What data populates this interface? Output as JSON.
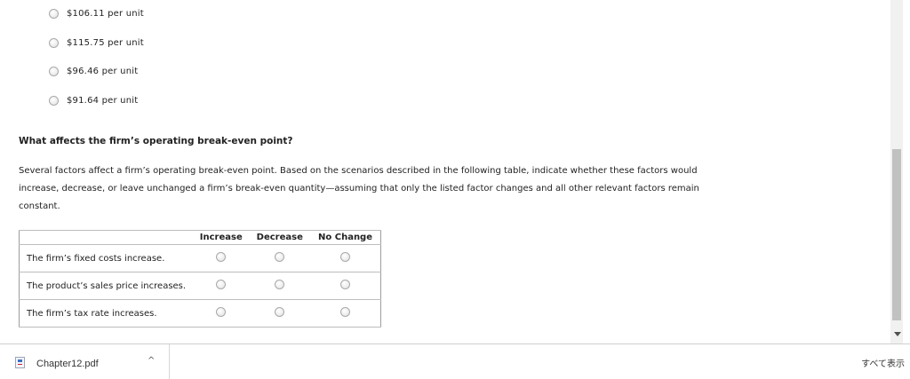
{
  "options": [
    {
      "label": "$106.11 per unit"
    },
    {
      "label": "$115.75 per unit"
    },
    {
      "label": "$96.46 per unit"
    },
    {
      "label": "$91.64 per unit"
    }
  ],
  "question": {
    "heading": "What affects the firm’s operating break-even point?",
    "paragraph": "Several factors affect a firm’s operating break-even point. Based on the scenarios described in the following table, indicate whether these factors would increase, decrease, or leave unchanged a firm’s break-even quantity—assuming that only the listed factor changes and all other relevant factors remain constant."
  },
  "table": {
    "headers": [
      "",
      "Increase",
      "Decrease",
      "No Change"
    ],
    "rows": [
      {
        "label": "The firm’s fixed costs increase."
      },
      {
        "label": "The product’s sales price increases."
      },
      {
        "label": "The firm’s tax rate increases."
      }
    ]
  },
  "download_bar": {
    "file_name": "Chapter12.pdf",
    "caret": "^",
    "show_all": "すべて表示"
  }
}
